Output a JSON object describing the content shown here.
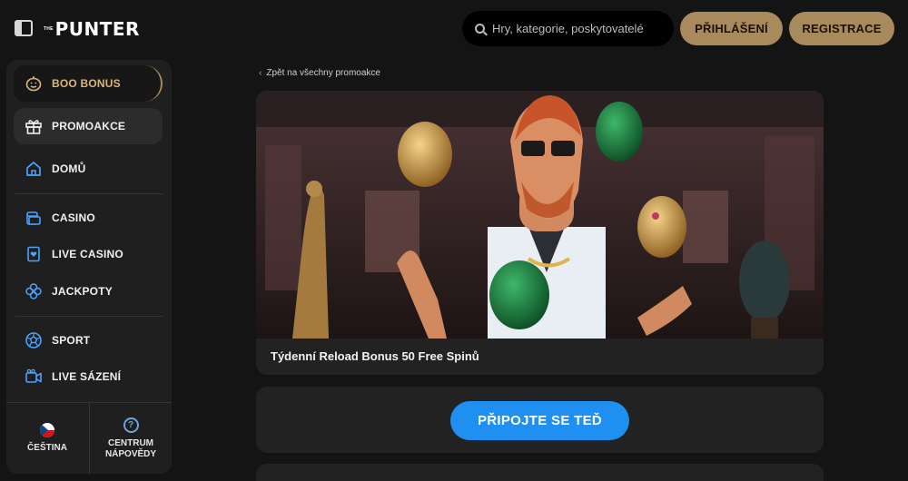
{
  "header": {
    "logo_small": "THE",
    "logo_text": "PUNTER",
    "search_placeholder": "Hry, kategorie, poskytovatelé",
    "login_label": "PŘIHLÁŠENÍ",
    "register_label": "REGISTRACE"
  },
  "sidebar": {
    "items": [
      {
        "label": "BOO BONUS",
        "icon": "pumpkin-icon"
      },
      {
        "label": "PROMOAKCE",
        "icon": "gift-icon"
      },
      {
        "label": "DOMŮ",
        "icon": "home-icon"
      },
      {
        "label": "CASINO",
        "icon": "casino-icon"
      },
      {
        "label": "LIVE CASINO",
        "icon": "card-heart-icon"
      },
      {
        "label": "JACKPOTY",
        "icon": "clover-icon"
      },
      {
        "label": "SPORT",
        "icon": "soccer-ball-icon"
      },
      {
        "label": "LIVE SÁZENÍ",
        "icon": "video-camera-icon"
      }
    ],
    "language_label": "ČEŠTINA",
    "help_label": "CENTRUM NÁPOVĚDY"
  },
  "main": {
    "back_link": "Zpět na všechny promoakce",
    "promo_title": "Týdenní Reload Bonus 50 Free Spinů",
    "cta_label": "PŘIPOJTE SE TEĎ"
  },
  "colors": {
    "accent_gold": "#a88a5c",
    "cta_blue": "#1f8ff2",
    "background": "#141414",
    "panel": "#1f1f1f"
  }
}
